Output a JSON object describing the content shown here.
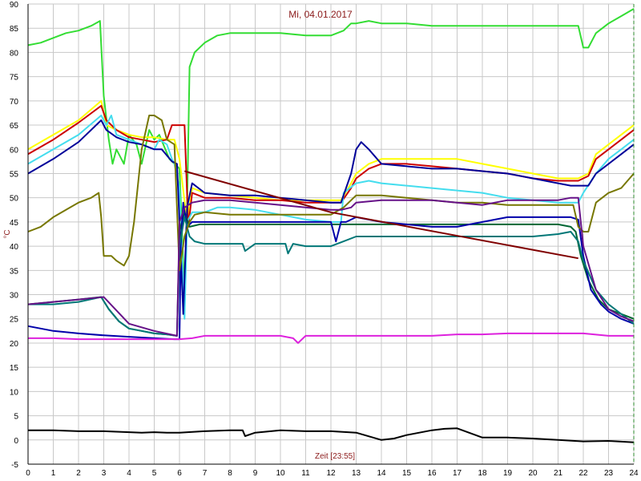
{
  "chart_data": {
    "type": "line",
    "title": "Mi, 04.01.2017",
    "xlabel": "Zeit [23:55]",
    "ylabel": "°C",
    "xlim": [
      0,
      24
    ],
    "ylim": [
      -5,
      90
    ],
    "x_ticks": [
      "0",
      "1",
      "2",
      "3",
      "4",
      "5",
      "6",
      "7",
      "8",
      "9",
      "10",
      "11",
      "12",
      "13",
      "14",
      "15",
      "16",
      "17",
      "18",
      "19",
      "20",
      "21",
      "22",
      "23",
      "24"
    ],
    "y_ticks": [
      "-5",
      "0",
      "5",
      "10",
      "15",
      "20",
      "25",
      "30",
      "35",
      "40",
      "45",
      "50",
      "55",
      "60",
      "65",
      "70",
      "75",
      "80",
      "85",
      "90"
    ],
    "grid": true,
    "legend": "none",
    "colors": {
      "background": "#ffffff",
      "grid": "#c8c8c8",
      "axis": "#000000",
      "marker_line": "#2e8b2e"
    },
    "series": [
      {
        "color": "#33dd33",
        "x": [
          0,
          0.5,
          1,
          1.5,
          2,
          2.5,
          2.85,
          3,
          3.2,
          3.35,
          3.5,
          3.8,
          4,
          4.3,
          4.5,
          4.8,
          5,
          5.2,
          5.6,
          6,
          6.2,
          6.3,
          6.4,
          6.6,
          7,
          7.5,
          8,
          9,
          10,
          11,
          11.5,
          12,
          12.5,
          12.8,
          13,
          13.5,
          14,
          15,
          16,
          17,
          18,
          19,
          20,
          21,
          21.5,
          21.8,
          22,
          22.2,
          22.5,
          23,
          23.5,
          24
        ],
        "y": [
          81.5,
          82,
          83,
          84,
          84.5,
          85.5,
          86.5,
          71,
          62,
          57,
          60,
          57,
          63,
          61,
          57,
          64,
          62,
          63,
          58,
          56,
          30,
          48,
          77,
          80,
          82,
          83.5,
          84,
          84,
          84,
          83.5,
          83.5,
          83.5,
          84.5,
          86,
          86,
          86.5,
          86,
          86,
          85.5,
          85.5,
          85.5,
          85.5,
          85.5,
          85.5,
          85.5,
          85.5,
          81,
          81,
          84,
          86,
          87.5,
          89
        ]
      },
      {
        "color": "#ffff00",
        "x": [
          0,
          1,
          2,
          2.9,
          3.1,
          3.5,
          4,
          4.5,
          5,
          5.5,
          5.8,
          6,
          6.3,
          6.5,
          7,
          8,
          9,
          10,
          11,
          12,
          12.4,
          12.8,
          13,
          13.5,
          14,
          15,
          16,
          17,
          18,
          19,
          20,
          21,
          21.8,
          22.2,
          22.5,
          23,
          23.5,
          24
        ],
        "y": [
          60,
          63,
          66,
          70,
          65,
          64,
          63,
          62.5,
          62.5,
          62,
          62,
          58,
          45,
          52,
          51,
          50.5,
          50,
          49.5,
          49.5,
          49.5,
          49.5,
          53,
          55,
          57,
          58,
          58,
          58,
          58,
          57,
          56,
          55,
          54,
          54,
          55,
          59,
          61,
          63,
          65
        ]
      },
      {
        "color": "#cc0000",
        "x": [
          0,
          1,
          2,
          2.9,
          3.1,
          3.5,
          4,
          4.5,
          5,
          5.5,
          5.7,
          5.8,
          6,
          6.2,
          6.35,
          6.5,
          7,
          8,
          9,
          10,
          11,
          12,
          12.4,
          12.8,
          13,
          13.5,
          14,
          15,
          16,
          17,
          18,
          19,
          20,
          21,
          21.8,
          22.2,
          22.5,
          23,
          23.5,
          24
        ],
        "y": [
          59,
          62,
          65.5,
          69,
          66,
          64,
          62.5,
          62,
          61.5,
          62,
          65,
          65,
          65,
          65,
          44,
          51,
          50,
          50,
          49.5,
          49.5,
          49,
          49,
          49,
          52,
          54,
          56,
          57,
          57,
          56.5,
          56,
          55.5,
          55,
          54,
          53.5,
          53.5,
          54.5,
          58,
          60,
          62,
          64
        ]
      },
      {
        "color": "#44ddee",
        "x": [
          0,
          1,
          2,
          2.9,
          3.1,
          3.3,
          3.5,
          4,
          4.5,
          5,
          5.2,
          5.5,
          5.7,
          5.8,
          6,
          6.2,
          6.3,
          6.5,
          7,
          7.5,
          8,
          9,
          10,
          11,
          12,
          12.4,
          12.5,
          13,
          13.5,
          14,
          15,
          16,
          17,
          18,
          19,
          20,
          21,
          21.5,
          21.8,
          22,
          22.5,
          23,
          23.5,
          24
        ],
        "y": [
          57,
          60,
          63,
          67,
          65,
          67,
          63,
          62,
          61,
          60,
          62,
          61,
          58,
          57,
          52,
          25,
          45,
          47,
          47,
          48,
          48,
          47.5,
          46.5,
          45.5,
          45,
          45,
          51,
          53,
          53.5,
          53,
          52.5,
          52,
          51.5,
          51,
          50,
          49.5,
          49,
          49,
          49,
          51,
          55,
          58,
          60,
          62
        ]
      },
      {
        "color": "#000099",
        "x": [
          0,
          1,
          2,
          2.9,
          3.1,
          3.5,
          4,
          4.5,
          5,
          5.3,
          5.7,
          5.9,
          6,
          6.15,
          6.3,
          6.5,
          7,
          8,
          9,
          10,
          11,
          12,
          12.4,
          12.8,
          13,
          13.2,
          13.5,
          14,
          15,
          16,
          17,
          18,
          19,
          20,
          21,
          21.5,
          21.8,
          22.2,
          22.5,
          23,
          23.5,
          24
        ],
        "y": [
          55,
          58,
          61.5,
          66,
          64,
          62.5,
          61.5,
          61,
          60,
          60,
          57.5,
          57,
          45,
          26,
          48,
          53,
          51,
          50.5,
          50.5,
          50,
          49.5,
          49,
          49,
          55,
          60,
          61.5,
          60,
          57,
          56.5,
          56,
          56,
          55.5,
          55,
          54,
          53,
          52.5,
          52.5,
          52.5,
          55,
          57,
          59,
          61
        ]
      },
      {
        "color": "#006633",
        "x": [
          0,
          1,
          2,
          2.9,
          3.2,
          3.6,
          4,
          4.5,
          5,
          5.5,
          5.9,
          6,
          6.2,
          6.4,
          6.8,
          7.5,
          8,
          9,
          10,
          11,
          12,
          13,
          14,
          15,
          16,
          17,
          18,
          19,
          20,
          21,
          21.5,
          21.7,
          21.9,
          22.2,
          22.6,
          23,
          23.5,
          24
        ],
        "y": [
          28,
          28.5,
          29,
          29.5,
          27,
          24.5,
          23,
          22.5,
          22,
          21.8,
          21.5,
          43,
          47,
          44,
          44.5,
          44.5,
          44.5,
          44.5,
          44.5,
          44.5,
          44.5,
          44.5,
          44.5,
          44.5,
          44.5,
          44.5,
          44.5,
          44.5,
          44.5,
          44.5,
          44,
          43,
          38,
          33,
          29,
          27,
          26,
          25
        ]
      },
      {
        "color": "#0000aa",
        "x": [
          0,
          0.5,
          1,
          2,
          3,
          4,
          5,
          5.8,
          6,
          6.05,
          6.15,
          6.3,
          6.5,
          7,
          8,
          9,
          10,
          11,
          12,
          12.2,
          12.4,
          12.6,
          13,
          14,
          15,
          16,
          17,
          18,
          19,
          20,
          21,
          21.5,
          21.8,
          22,
          22.3,
          22.7,
          23,
          23.5,
          24
        ],
        "y": [
          23.5,
          23,
          22.5,
          22,
          21.6,
          21.3,
          21,
          20.8,
          20.8,
          40,
          49,
          44,
          45,
          45,
          45,
          45,
          45,
          45,
          45,
          41,
          45,
          45,
          46,
          45,
          44.5,
          44,
          44,
          45,
          46,
          46,
          46,
          46,
          45.5,
          38,
          31,
          28,
          26.5,
          25,
          24
        ]
      },
      {
        "color": "#007777",
        "x": [
          0,
          1,
          2,
          2.9,
          3.2,
          3.6,
          4,
          4.5,
          5,
          5.5,
          5.9,
          6,
          6.2,
          6.4,
          6.6,
          7,
          8,
          8.5,
          8.6,
          9,
          10,
          10.2,
          10.3,
          10.5,
          11,
          12,
          12.5,
          13,
          14,
          15,
          16,
          17,
          18,
          19,
          20,
          21,
          21.5,
          21.8,
          22,
          22.5,
          23,
          23.5,
          24
        ],
        "y": [
          28,
          28,
          28.5,
          29.5,
          27,
          24.5,
          23,
          22.5,
          22,
          21.8,
          21.5,
          40,
          46,
          42,
          41,
          40.5,
          40.5,
          40.5,
          39,
          40.5,
          40.5,
          40.5,
          38.5,
          40.5,
          40,
          40,
          41,
          42,
          42,
          42,
          42,
          42,
          42,
          42,
          42,
          42.5,
          43,
          41,
          37,
          31,
          28,
          26,
          24
        ]
      },
      {
        "color": "#777700",
        "x": [
          0,
          0.5,
          1,
          1.5,
          2,
          2.5,
          2.8,
          2.9,
          3,
          3.3,
          3.5,
          3.8,
          4,
          4.2,
          4.5,
          4.8,
          5,
          5.3,
          5.5,
          5.8,
          6,
          6.2,
          6.4,
          6.6,
          7,
          8,
          9,
          10,
          11,
          12,
          12.5,
          13,
          14,
          15,
          16,
          17,
          18,
          19,
          20,
          21,
          21.6,
          21.8,
          22,
          22.2,
          22.5,
          23,
          23.5,
          24
        ],
        "y": [
          43,
          44,
          46,
          47.5,
          49,
          50,
          51,
          46,
          38,
          38,
          37,
          36,
          38,
          45,
          60,
          67,
          67,
          66,
          62,
          61,
          35,
          42,
          45,
          46.5,
          47,
          46.5,
          46.5,
          46.5,
          46.5,
          46.5,
          48,
          50.5,
          50.5,
          50,
          49.5,
          49,
          49,
          48.5,
          48.5,
          48.5,
          48.5,
          44,
          43,
          43,
          49,
          51,
          52,
          55
        ]
      },
      {
        "color": "#661188",
        "x": [
          0,
          1,
          2,
          3,
          4,
          5,
          5.9,
          6,
          6.2,
          6.5,
          7,
          8,
          9,
          10,
          11,
          12,
          12.4,
          12.8,
          13,
          14,
          15,
          16,
          17,
          18,
          19,
          20,
          21,
          21.5,
          21.8,
          22,
          22.5,
          23,
          23.5,
          24
        ],
        "y": [
          28,
          28.5,
          29,
          29.5,
          24,
          22.5,
          21.5,
          45,
          48,
          49,
          49.5,
          49.5,
          49,
          48.5,
          48,
          47.5,
          47.5,
          48,
          49,
          49.5,
          49.5,
          49.5,
          49,
          48.5,
          49.5,
          49.5,
          49.5,
          50,
          50,
          40,
          31,
          27,
          25.5,
          24.5
        ]
      },
      {
        "color": "#800000",
        "x": [
          6.2,
          12,
          21.8
        ],
        "y": [
          55.5,
          47,
          37.5
        ]
      },
      {
        "color": "#dd22dd",
        "x": [
          0,
          1,
          2,
          3,
          4,
          5,
          6,
          6.5,
          7,
          8,
          9,
          10,
          10.5,
          10.7,
          11,
          12,
          13,
          14,
          15,
          16,
          17,
          18,
          19,
          20,
          21,
          22,
          23,
          24
        ],
        "y": [
          21,
          21,
          20.8,
          20.8,
          20.8,
          20.8,
          20.8,
          21,
          21.5,
          21.5,
          21.5,
          21.5,
          21,
          20,
          21.5,
          21.5,
          21.5,
          21.5,
          21.5,
          21.5,
          21.8,
          21.8,
          22,
          22,
          22,
          22,
          21.5,
          21.5
        ]
      },
      {
        "color": "#000000",
        "x": [
          0,
          1,
          2,
          3,
          4,
          4.5,
          5,
          5.5,
          6,
          7,
          8,
          8.5,
          8.6,
          9,
          10,
          11,
          12,
          13,
          14,
          14.5,
          15,
          16,
          16.5,
          17,
          18,
          19,
          20,
          21,
          22,
          23,
          24
        ],
        "y": [
          2,
          2,
          1.8,
          1.8,
          1.6,
          1.5,
          1.6,
          1.5,
          1.5,
          1.8,
          2,
          2,
          0.8,
          1.5,
          2,
          1.8,
          1.8,
          1.5,
          0,
          0.3,
          1,
          2,
          2.3,
          2.4,
          0.5,
          0.5,
          0.3,
          0,
          -0.3,
          -0.2,
          -0.5
        ]
      }
    ]
  }
}
